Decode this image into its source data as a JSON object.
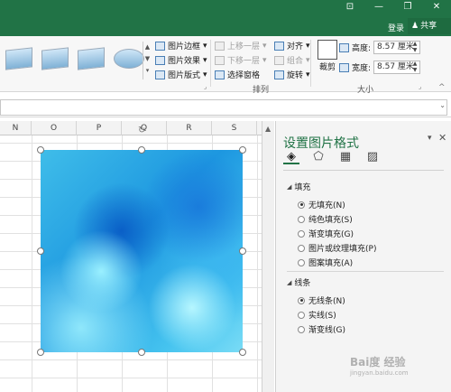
{
  "title_bar": {
    "login": "登录",
    "share": "共享",
    "window_buttons": [
      "⊡",
      "—",
      "❐",
      "✕"
    ]
  },
  "ribbon": {
    "picture_styles": {
      "border": "图片边框",
      "effects": "图片效果",
      "layout": "图片版式"
    },
    "arrange": {
      "bring_forward": "上移一层",
      "send_backward": "下移一层",
      "selection_pane": "选择窗格",
      "align": "对齐",
      "group": "组合",
      "rotate": "旋转",
      "group_label": "排列"
    },
    "size": {
      "crop": "裁剪",
      "height_label": "高度:",
      "height_value": "8.57 厘米",
      "width_label": "宽度:",
      "width_value": "8.57 厘米",
      "group_label": "大小"
    }
  },
  "grid": {
    "columns": [
      "N",
      "O",
      "P",
      "Q",
      "R",
      "S"
    ]
  },
  "format_pane": {
    "title": "设置图片格式",
    "fill_section": "填充",
    "fill_options": [
      {
        "label": "无填充(N)",
        "selected": true
      },
      {
        "label": "纯色填充(S)",
        "selected": false
      },
      {
        "label": "渐变填充(G)",
        "selected": false
      },
      {
        "label": "图片或纹理填充(P)",
        "selected": false
      },
      {
        "label": "图案填充(A)",
        "selected": false
      }
    ],
    "line_section": "线条",
    "line_options": [
      {
        "label": "无线条(N)",
        "selected": true
      },
      {
        "label": "实线(S)",
        "selected": false
      },
      {
        "label": "渐变线(G)",
        "selected": false
      }
    ]
  },
  "watermark": {
    "text": "Bai度 经验",
    "sub": "jingyan.baidu.com"
  },
  "colors": {
    "accent": "#217346"
  }
}
